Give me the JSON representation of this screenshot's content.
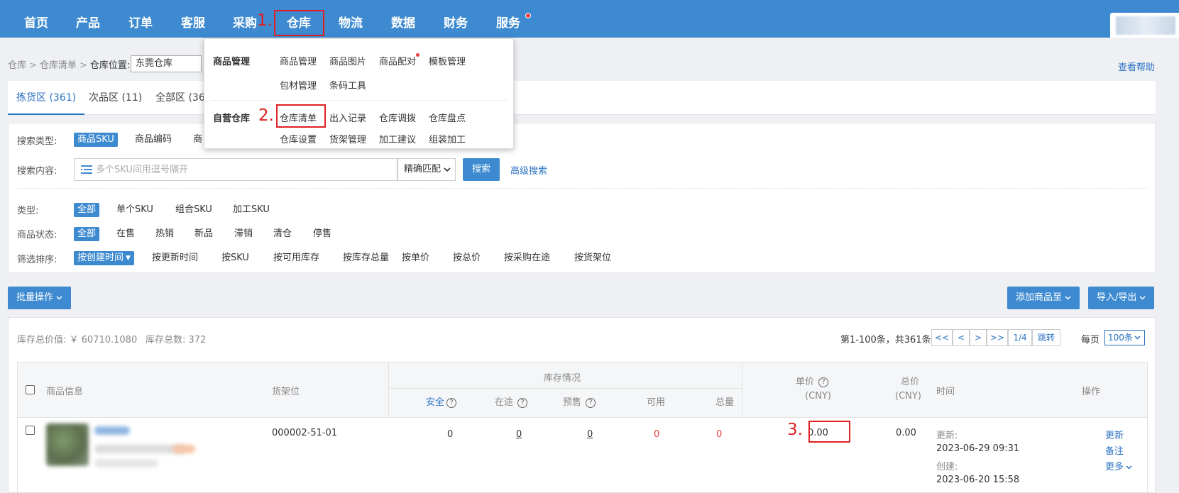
{
  "nav": {
    "items": [
      "首页",
      "产品",
      "订单",
      "客服",
      "采购",
      "仓库",
      "物流",
      "数据",
      "财务",
      "服务"
    ]
  },
  "annotations": [
    "1.",
    "2.",
    "3."
  ],
  "breadcrumb": {
    "root": "仓库",
    "page": "仓库清单",
    "location_label": "仓库位置:",
    "location_value": "东莞仓库",
    "help": "查看帮助"
  },
  "tabs": [
    "拣货区 (361)",
    "次品区 (11)",
    "全部区 (36"
  ],
  "search": {
    "type_label": "搜索类型:",
    "types": [
      "商品SKU",
      "商品编码",
      "商"
    ],
    "content_label": "搜索内容:",
    "placeholder": "多个SKU间用逗号隔开",
    "match": "精确匹配",
    "search_btn": "搜索",
    "advanced": "高级搜索"
  },
  "filters": {
    "type_label": "类型:",
    "types": [
      "全部",
      "单个SKU",
      "组合SKU",
      "加工SKU"
    ],
    "status_label": "商品状态:",
    "statuses": [
      "全部",
      "在售",
      "热销",
      "新品",
      "滞销",
      "清仓",
      "停售"
    ],
    "sort_label": "筛选排序:",
    "sorts": [
      "按创建时间",
      "按更新时间",
      "按SKU",
      "按可用库存",
      "按库存总量",
      "按单价",
      "按总价",
      "按采购在途",
      "按货架位"
    ]
  },
  "toolbar": {
    "batch": "批量操作",
    "add_to": "添加商品至",
    "import_export": "导入/导出"
  },
  "stats": {
    "total_value": "库存总价值: ￥ 60710.1080",
    "total_count": "库存总数: 372"
  },
  "pager": {
    "info": "第1-100条，共361条",
    "buttons": [
      "<<",
      "<",
      ">",
      ">>",
      "1/4",
      "跳转"
    ],
    "per_label": "每页",
    "per_value": "100条"
  },
  "table": {
    "headers": {
      "product": "商品信息",
      "shelf": "货架位",
      "stock_group": "库存情况",
      "safe": "安全",
      "in_transit": "在途",
      "presale": "预售",
      "available": "可用",
      "total": "总量",
      "unit_price": "单价",
      "unit_price_cur": "(CNY)",
      "total_price": "总价",
      "total_price_cur": "(CNY)",
      "time": "时间",
      "ops": "操作"
    },
    "rows": [
      {
        "shelf": "000002-51-01",
        "safe": "0",
        "in_transit": "0",
        "presale": "0",
        "available": "0",
        "total": "0",
        "unit_price": "0.00",
        "total_price": "0.00",
        "updated_label": "更新:",
        "updated": "2023-06-29 09:31",
        "created_label": "创建:",
        "created": "2023-06-20 15:58",
        "ops": [
          "更新",
          "备注",
          "更多"
        ]
      }
    ]
  },
  "dropdown": {
    "groups": [
      {
        "title": "商品管理",
        "items": [
          "商品管理",
          "商品图片",
          "商品配对",
          "模板管理",
          "包材管理",
          "条码工具"
        ]
      },
      {
        "title": "自营仓库",
        "items": [
          "仓库清单",
          "出入记录",
          "仓库调拨",
          "仓库盘点",
          "仓库设置",
          "货架管理",
          "加工建议",
          "组装加工"
        ]
      }
    ]
  },
  "colors": {
    "nav_bg": "#3d8ad0",
    "accent": "#2a72c4",
    "highlight": "#e02020",
    "danger": "#e63e3e"
  }
}
